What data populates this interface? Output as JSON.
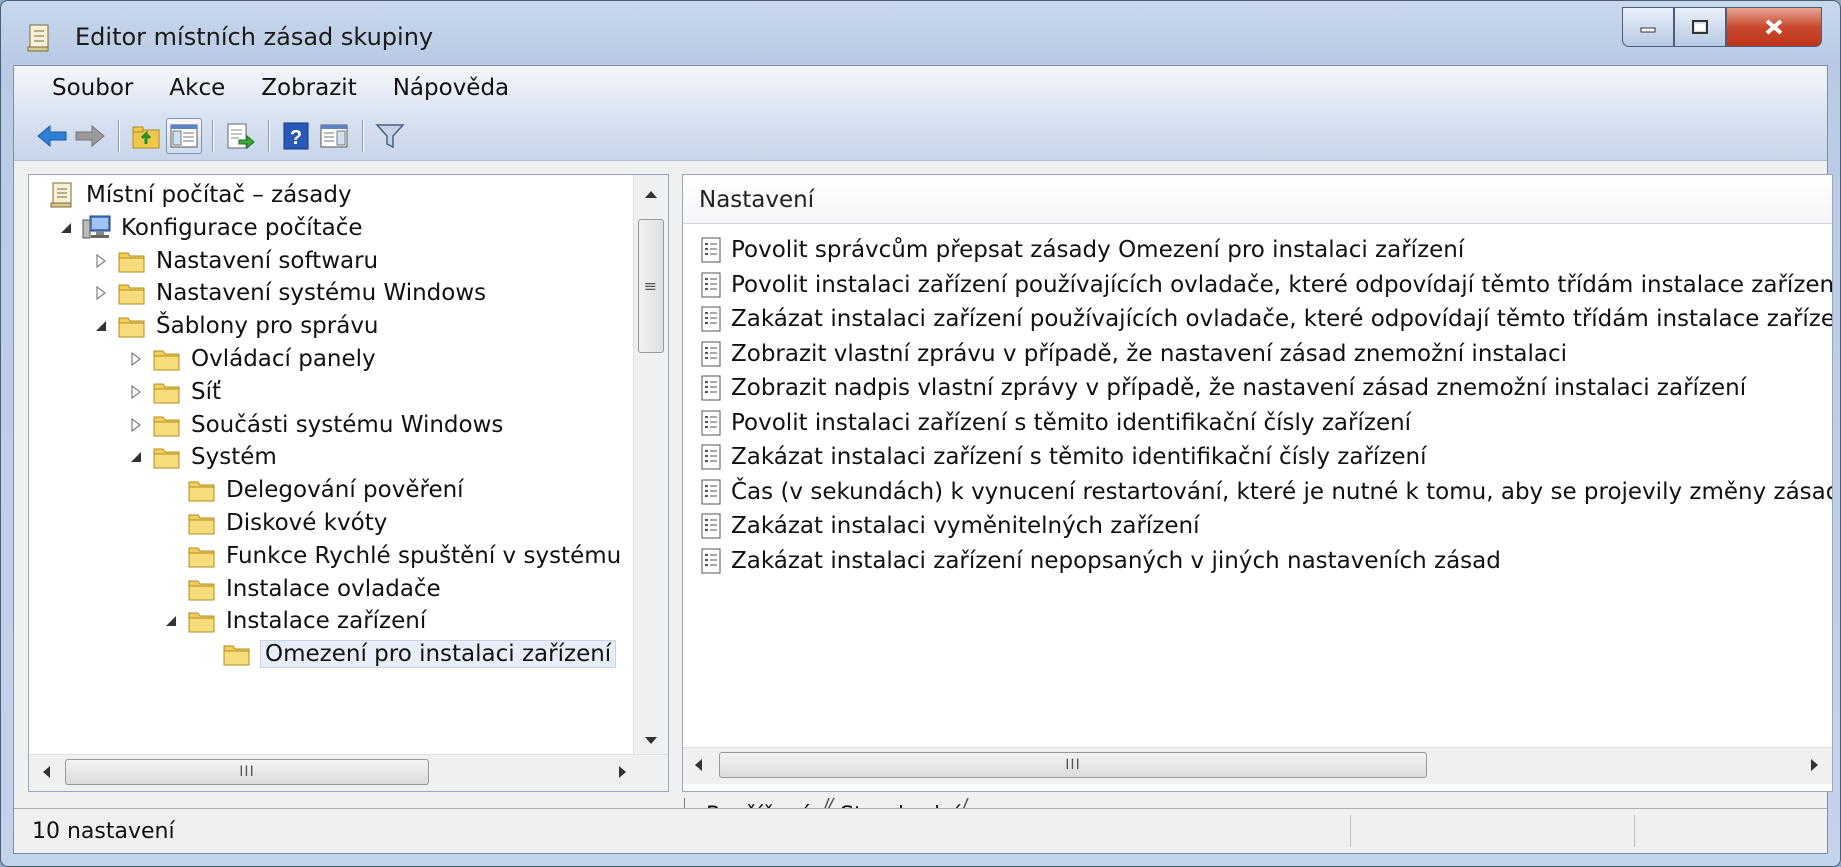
{
  "window": {
    "title": "Editor místních zásad skupiny"
  },
  "menu": [
    "Soubor",
    "Akce",
    "Zobrazit",
    "Nápověda"
  ],
  "toolbar": {
    "buttons": [
      {
        "name": "back-button",
        "icon": "arrow-left-icon"
      },
      {
        "name": "forward-button",
        "icon": "arrow-right-icon"
      },
      {
        "name": "up-button",
        "icon": "folder-up-icon"
      },
      {
        "name": "show-hide-tree-button",
        "icon": "console-tree-icon"
      },
      {
        "name": "export-list-button",
        "icon": "export-icon"
      },
      {
        "name": "help-button",
        "icon": "help-icon"
      },
      {
        "name": "show-hide-action-pane-button",
        "icon": "action-pane-icon"
      },
      {
        "name": "filter-button",
        "icon": "filter-icon"
      }
    ]
  },
  "tree": {
    "items": [
      {
        "label": "Místní počítač – zásady",
        "level": 0,
        "icon": "policy-icon",
        "expander": "none"
      },
      {
        "label": "Konfigurace počítače",
        "level": 1,
        "icon": "computer-icon",
        "expander": "expanded"
      },
      {
        "label": "Nastavení softwaru",
        "level": 2,
        "icon": "folder-icon",
        "expander": "collapsed"
      },
      {
        "label": "Nastavení systému Windows",
        "level": 2,
        "icon": "folder-icon",
        "expander": "collapsed"
      },
      {
        "label": "Šablony pro správu",
        "level": 2,
        "icon": "folder-icon",
        "expander": "expanded"
      },
      {
        "label": "Ovládací panely",
        "level": 3,
        "icon": "folder-icon",
        "expander": "collapsed"
      },
      {
        "label": "Síť",
        "level": 3,
        "icon": "folder-icon",
        "expander": "collapsed"
      },
      {
        "label": "Součásti systému Windows",
        "level": 3,
        "icon": "folder-icon",
        "expander": "collapsed"
      },
      {
        "label": "Systém",
        "level": 3,
        "icon": "folder-icon",
        "expander": "expanded"
      },
      {
        "label": "Delegování pověření",
        "level": 4,
        "icon": "folder-icon",
        "expander": "none"
      },
      {
        "label": "Diskové kvóty",
        "level": 4,
        "icon": "folder-icon",
        "expander": "none"
      },
      {
        "label": "Funkce Rychlé spuštění v systému",
        "level": 4,
        "icon": "folder-icon",
        "expander": "none"
      },
      {
        "label": "Instalace ovladače",
        "level": 4,
        "icon": "folder-icon",
        "expander": "none"
      },
      {
        "label": "Instalace zařízení",
        "level": 4,
        "icon": "folder-icon",
        "expander": "expanded"
      },
      {
        "label": "Omezení pro instalaci zařízení",
        "level": 5,
        "icon": "folder-icon",
        "expander": "none",
        "selected": true
      }
    ],
    "scrollbar_grip": "≡",
    "hscroll_grip": "III"
  },
  "list": {
    "column_header": "Nastavení",
    "rows": [
      "Povolit správcům přepsat zásady Omezení pro instalaci zařízení",
      "Povolit instalaci zařízení používajících ovladače, které odpovídají těmto třídám instalace zařízení",
      "Zakázat instalaci zařízení používajících ovladače, které odpovídají těmto třídám instalace zařízení",
      "Zobrazit vlastní zprávu v případě, že nastavení zásad znemožní instalaci",
      "Zobrazit nadpis vlastní zprávy v případě, že nastavení zásad znemožní instalaci zařízení",
      "Povolit instalaci zařízení s těmito identifikační čísly zařízení",
      "Zakázat instalaci zařízení s těmito identifikační čísly zařízení",
      "Čas (v sekundách) k vynucení restartování, které je nutné k tomu, aby se projevily změny zásad",
      "Zakázat instalaci vyměnitelných zařízení",
      "Zakázat instalaci zařízení nepopsaných v jiných nastaveních zásad"
    ],
    "hscroll_grip": "III"
  },
  "tabs": [
    {
      "label": "Rozšířené",
      "active": false
    },
    {
      "label": "Standardní",
      "active": true
    }
  ],
  "status": {
    "text": "10 nastavení"
  },
  "colors": {
    "title_bar": "#c9d8ec",
    "close_button": "#c84a2e",
    "selection": "#e8eef8"
  }
}
